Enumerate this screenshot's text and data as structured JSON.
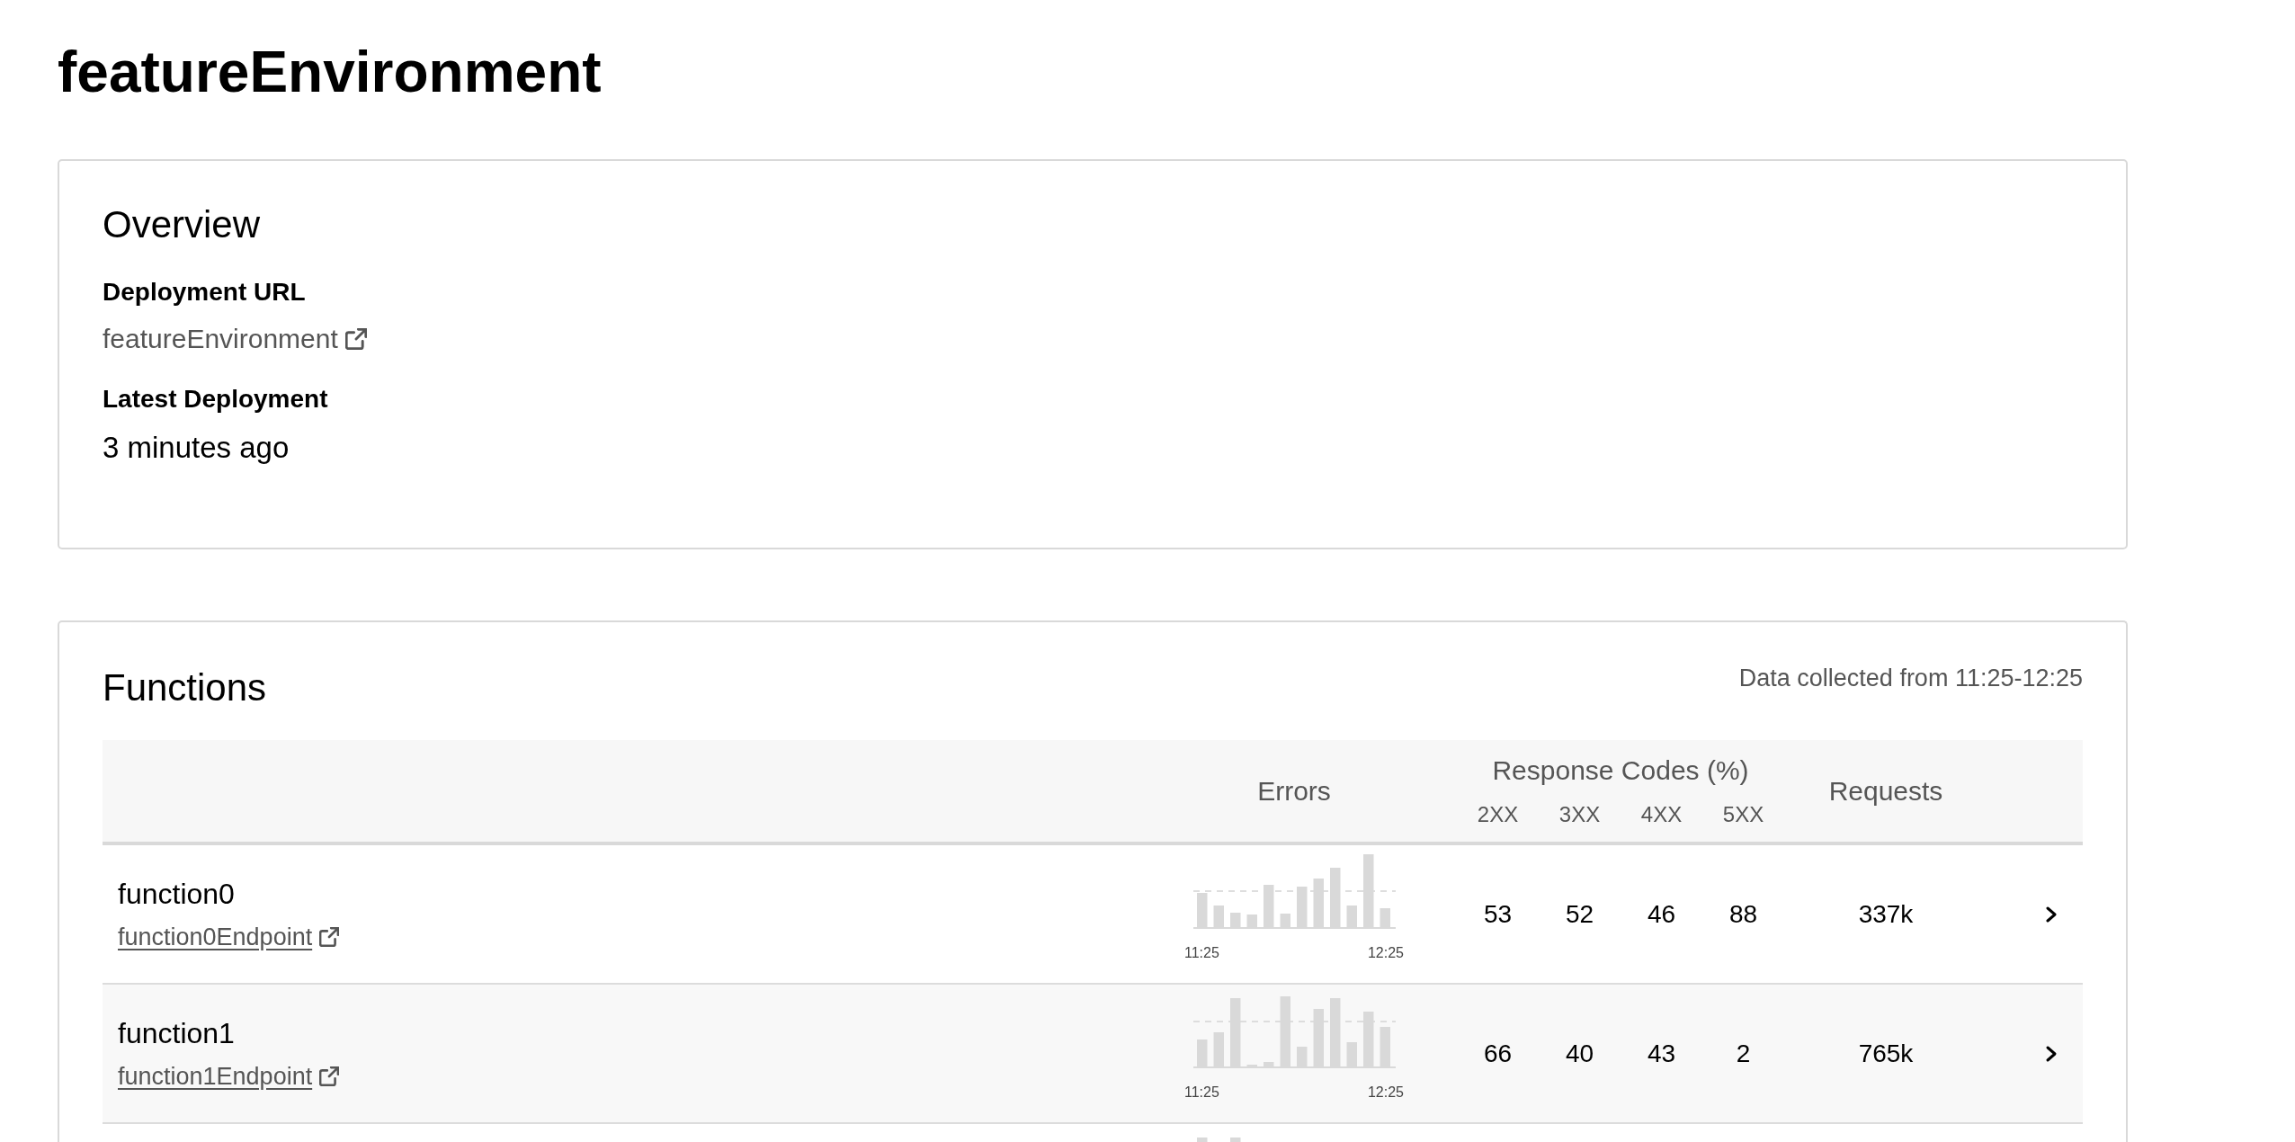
{
  "page": {
    "title": "featureEnvironment"
  },
  "overview": {
    "title": "Overview",
    "fields": [
      {
        "kind": "link",
        "label": "Deployment URL",
        "value": "featureEnvironment"
      },
      {
        "kind": "text",
        "label": "Latest Deployment",
        "value": "3 minutes ago"
      }
    ]
  },
  "functions": {
    "title": "Functions",
    "data_range": "Data collected from 11:25-12:25",
    "table": {
      "errors_header": "Errors",
      "codes_header": {
        "title": "Response Codes (%)",
        "codes": [
          "2XX",
          "3XX",
          "4XX",
          "5XX"
        ]
      },
      "requests_header": "Requests",
      "rows": [
        {
          "name": "function0",
          "endpoint": "function0Endpoint",
          "errors_axis": [
            "11:25",
            "12:25"
          ],
          "codes": [
            "53",
            "52",
            "46",
            "88"
          ],
          "requests": "337k"
        },
        {
          "name": "function1",
          "endpoint": "function1Endpoint",
          "errors_axis": [
            "11:25",
            "12:25"
          ],
          "codes": [
            "66",
            "40",
            "43",
            "2"
          ],
          "requests": "765k"
        }
      ]
    }
  }
}
